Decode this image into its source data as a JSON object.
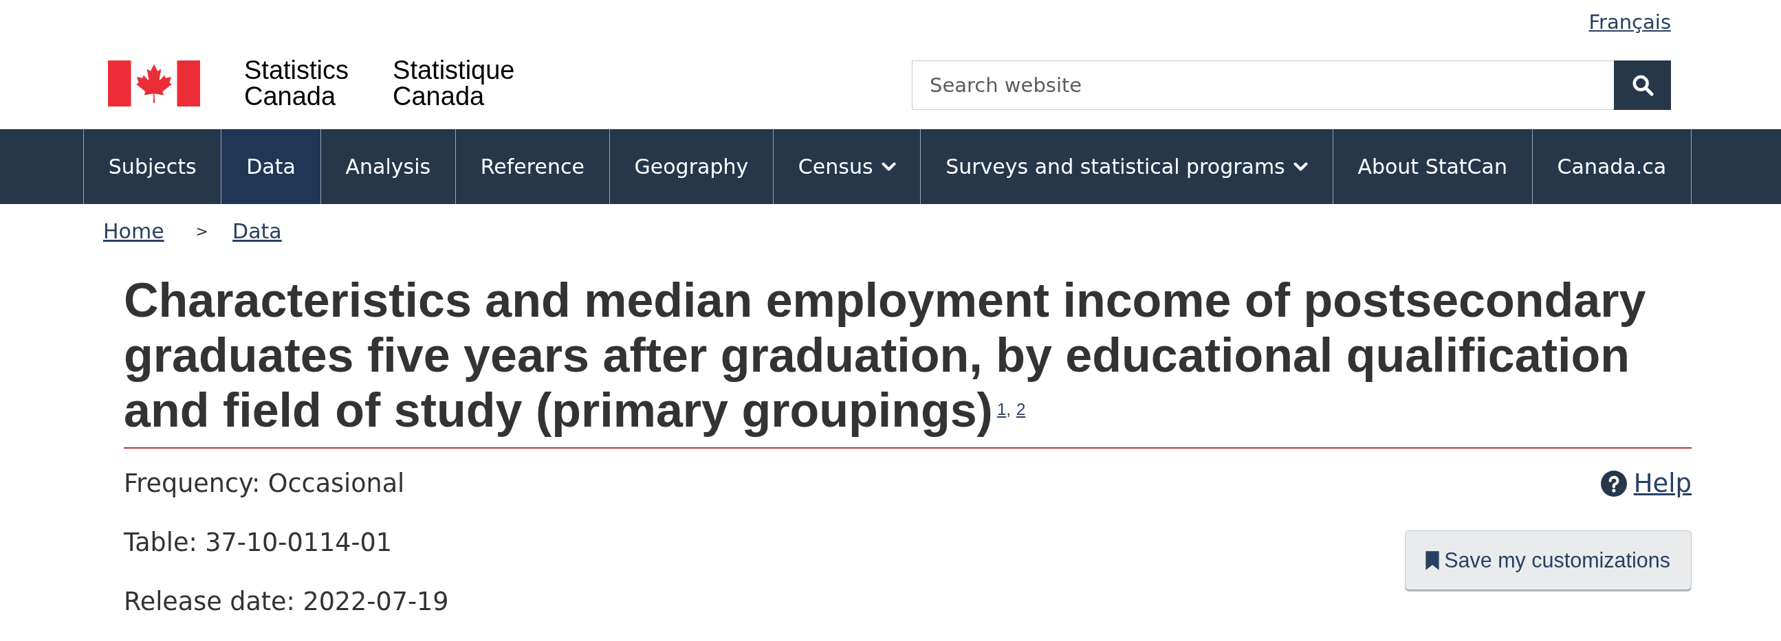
{
  "language_link": "Français",
  "agency_names": [
    "Statistics Canada",
    "Statistique Canada"
  ],
  "search": {
    "placeholder": "Search website"
  },
  "nav": [
    {
      "label": "Subjects",
      "selected": false,
      "dropdown": false
    },
    {
      "label": "Data",
      "selected": true,
      "dropdown": false
    },
    {
      "label": "Analysis",
      "selected": false,
      "dropdown": false
    },
    {
      "label": "Reference",
      "selected": false,
      "dropdown": false
    },
    {
      "label": "Geography",
      "selected": false,
      "dropdown": false
    },
    {
      "label": "Census",
      "selected": false,
      "dropdown": true
    },
    {
      "label": "Surveys and statistical programs",
      "selected": false,
      "dropdown": true
    },
    {
      "label": "About StatCan",
      "selected": false,
      "dropdown": false
    },
    {
      "label": "Canada.ca",
      "selected": false,
      "dropdown": false
    }
  ],
  "breadcrumb": {
    "separator": ">",
    "items": [
      "Home",
      "Data"
    ]
  },
  "title": {
    "text": "Characteristics and median employment income of postsecondary graduates five years after graduation, by educational qualification and field of study (primary groupings)",
    "footnotes": [
      "1",
      "2"
    ],
    "footnote_separator": ","
  },
  "details": [
    "Frequency: Occasional",
    "Table: 37-10-0114-01",
    "Release date: 2022-07-19"
  ],
  "help_link": "Help",
  "save_button": "Save my customizations"
}
